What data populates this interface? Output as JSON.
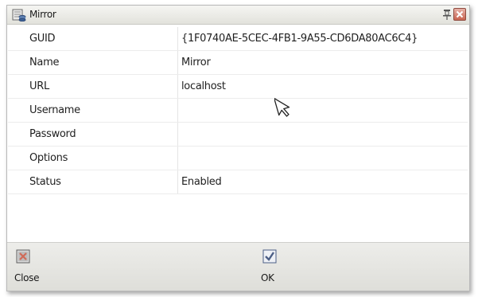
{
  "window": {
    "title": "Mirror"
  },
  "properties": [
    {
      "key": "GUID",
      "value": "{1F0740AE-5CEC-4FB1-9A55-CD6DA80AC6C4}"
    },
    {
      "key": "Name",
      "value": "Mirror"
    },
    {
      "key": "URL",
      "value": "localhost"
    },
    {
      "key": "Username",
      "value": ""
    },
    {
      "key": "Password",
      "value": ""
    },
    {
      "key": "Options",
      "value": ""
    },
    {
      "key": "Status",
      "value": "Enabled"
    }
  ],
  "toolbar": {
    "close_label": "Close",
    "ok_label": "OK"
  },
  "icons": {
    "title": "database-icon",
    "pin": "pin-icon",
    "close": "close-icon",
    "ok": "check-icon"
  },
  "colors": {
    "close_icon": "#d06a57",
    "check_icon": "#4c5f86"
  }
}
